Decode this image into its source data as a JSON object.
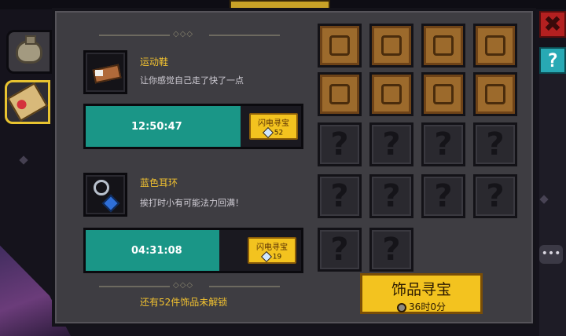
{
  "side_tabs": [
    {
      "name": "bag-tab",
      "icon": "bag-icon"
    },
    {
      "name": "accessory-tab",
      "icon": "scroll-icon",
      "selected": true
    }
  ],
  "buttons": {
    "close_icon": "✖",
    "help_icon": "?"
  },
  "items": [
    {
      "name": "运动鞋",
      "desc": "让你感觉自己走了快了一点",
      "timer": "12:50:47",
      "progress": 0.72,
      "flash_label": "闪电寻宝",
      "flash_cost": "52"
    },
    {
      "name": "蓝色耳环",
      "desc": "挨打时小有可能法力回满！",
      "timer": "04:31:08",
      "progress": 0.62,
      "flash_label": "闪电寻宝",
      "flash_cost": "19"
    }
  ],
  "remaining_text": "还有52件饰品未解锁",
  "grid": {
    "rows": [
      [
        "scroll",
        "scroll",
        "scroll",
        "scroll"
      ],
      [
        "scroll",
        "scroll",
        "scroll",
        "scroll"
      ],
      [
        "locked",
        "locked",
        "locked",
        "locked"
      ],
      [
        "locked",
        "locked",
        "locked",
        "locked"
      ],
      [
        "locked",
        "locked"
      ]
    ],
    "locked_glyph": "?"
  },
  "treasure_button": {
    "title": "饰品寻宝",
    "time": "36时0分"
  },
  "chat_icon": "•••",
  "colors": {
    "accent": "#f3c31f",
    "teal": "#1a9687",
    "panel": "#3e3d42"
  }
}
